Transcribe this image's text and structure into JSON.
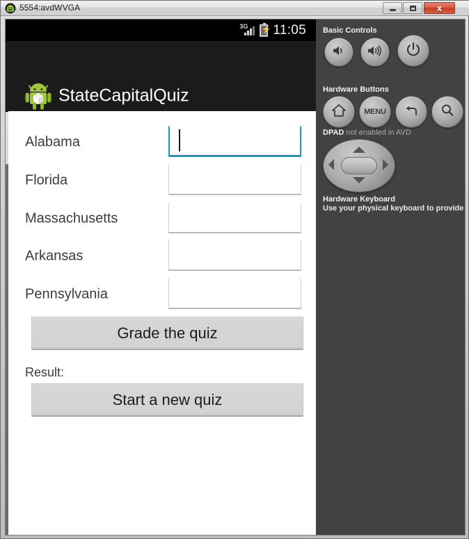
{
  "window": {
    "title": "5554:avdWVGA",
    "icon": "android-head-icon",
    "controls": {
      "minimize": "minimize-icon",
      "maximize": "maximize-icon",
      "close": "x"
    }
  },
  "statusbar": {
    "network_label": "3G",
    "signal_icon": "signal-bars-icon",
    "battery_icon": "battery-charging-icon",
    "clock": "11:05"
  },
  "actionbar": {
    "app_icon": "android-robot-icon",
    "app_title": "StateCapitalQuiz"
  },
  "quiz": {
    "rows": [
      {
        "state": "Alabama",
        "answer": "",
        "focused": true
      },
      {
        "state": "Florida",
        "answer": "",
        "focused": false
      },
      {
        "state": "Massachusetts",
        "answer": "",
        "focused": false
      },
      {
        "state": "Arkansas",
        "answer": "",
        "focused": false
      },
      {
        "state": "Pennsylvania",
        "answer": "",
        "focused": false
      }
    ],
    "grade_button": "Grade the quiz",
    "result_label": "Result:",
    "result_value": "",
    "new_quiz_button": "Start a new quiz",
    "focus_accent_color": "#0d9dd0"
  },
  "panel": {
    "basic_controls_heading": "Basic Controls",
    "basic_controls": [
      {
        "name": "volume-down-button",
        "icon": "speaker-low-icon"
      },
      {
        "name": "volume-up-button",
        "icon": "speaker-high-icon"
      },
      {
        "name": "power-button",
        "icon": "power-icon"
      }
    ],
    "hardware_buttons_heading": "Hardware Buttons",
    "hardware_buttons": [
      {
        "name": "home-button",
        "icon": "home-icon",
        "label": ""
      },
      {
        "name": "menu-button",
        "icon": "menu-icon",
        "label": "MENU"
      },
      {
        "name": "back-button",
        "icon": "back-arrow-icon",
        "label": ""
      },
      {
        "name": "search-button",
        "icon": "search-icon",
        "label": ""
      }
    ],
    "dpad_title": "DPAD",
    "dpad_status": "not enabled in AVD",
    "keyboard_heading": "Hardware Keyboard",
    "keyboard_hint": "Use your physical keyboard to provide input",
    "background_color": "#424242"
  }
}
